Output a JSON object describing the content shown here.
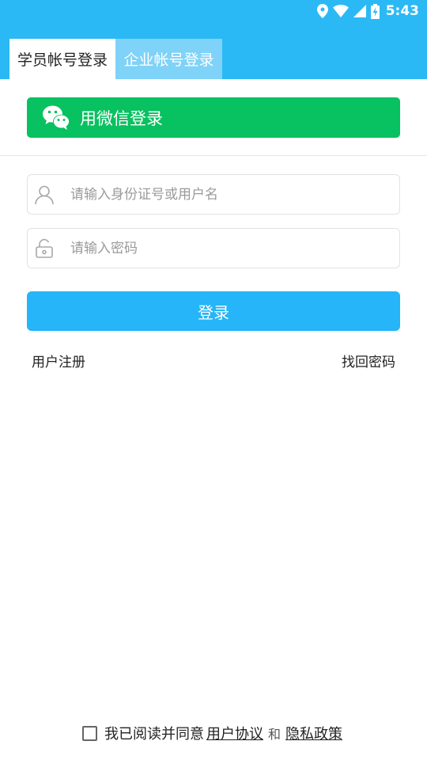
{
  "status_bar": {
    "time": "5:43",
    "icons": [
      "location-icon",
      "wifi-icon",
      "cellular-signal-icon",
      "battery-charging-icon"
    ]
  },
  "tabs": [
    {
      "label": "学员帐号登录",
      "active": true
    },
    {
      "label": "企业帐号登录",
      "active": false
    }
  ],
  "wechat_login": {
    "label": "用微信登录",
    "icon": "wechat-icon"
  },
  "form": {
    "username_placeholder": "请输入身份证号或用户名",
    "username_value": "",
    "password_placeholder": "请输入密码",
    "password_value": "",
    "login_label": "登录"
  },
  "links": {
    "register": "用户注册",
    "forgot_password": "找回密码"
  },
  "agreement": {
    "checked": false,
    "prefix": "我已阅读并同意",
    "user_agreement": "用户协议",
    "and": "和",
    "privacy_policy": "隐私政策"
  },
  "colors": {
    "header": "#2bb9f5",
    "tab_inactive": "#7fd2f8",
    "wechat_green": "#08c160",
    "login_button": "#25b5f8"
  }
}
